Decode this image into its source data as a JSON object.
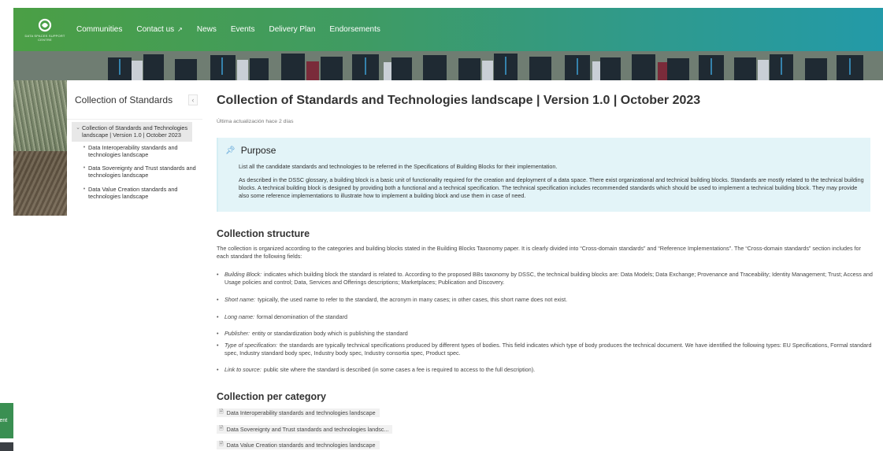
{
  "header": {
    "logo_text": "DATA SPACES SUPPORT CENTRE",
    "nav": [
      {
        "label": "Communities",
        "external": false
      },
      {
        "label": "Contact us",
        "external": true
      },
      {
        "label": "News",
        "external": false
      },
      {
        "label": "Events",
        "external": false
      },
      {
        "label": "Delivery Plan",
        "external": false
      },
      {
        "label": "Endorsements",
        "external": false
      }
    ],
    "colors": {
      "gradient_start": "#4b9f45",
      "gradient_end": "#239aa8"
    }
  },
  "sidebar": {
    "title": "Collection of Standards",
    "collapse_icon": "chevron-left-icon",
    "items": [
      {
        "label": "Collection of Standards and Technologies landscape | Version 1.0 | October 2023",
        "active": true
      },
      {
        "label": "Data Interoperability standards and technologies landscape",
        "active": false
      },
      {
        "label": "Data Sovereignty and Trust standards and technologies landscape",
        "active": false
      },
      {
        "label": "Data Value Creation standards and technologies landscape",
        "active": false
      }
    ]
  },
  "main": {
    "title": "Collection of Standards and Technologies landscape | Version 1.0 | October 2023",
    "last_updated": "Última actualización hace 2 días",
    "purpose": {
      "icon": "pin-icon",
      "title": "Purpose",
      "paragraphs": [
        "List all the candidate standards and technologies to be referred in the Specifications of Building Blocks for their implementation.",
        "As described in the DSSC glossary, a building block is a basic unit of functionality required for the creation and deployment of a data space. There exist organizational and technical building blocks. Standards are mostly related to the technical building blocks. A technical building block is designed by providing both a functional and a technical specification. The technical specification includes recommended standards which should be used to implement a technical building block. They may provide also some reference implementations to illustrate how to implement a building block and use them in case of need."
      ]
    },
    "structure": {
      "heading": "Collection structure",
      "intro": "The collection is organized according to the categories and building blocks stated in the Building Blocks Taxonomy paper. It is clearly divided into “Cross-domain standards” and “Reference Implementations”. The “Cross-domain standards” section includes for each standard the following fields:",
      "fields": [
        {
          "term": "Building Block:",
          "text": "indicates which building block the standard is related to. According to the proposed BBs taxonomy by DSSC, the technical building blocks are: Data Models; Data Exchange; Provenance and Traceability; Identity Management; Trust; Access and Usage policies and control; Data, Services and Offerings descriptions; Marketplaces; Publication and Discovery."
        },
        {
          "term": "Short name:",
          "text": "typically, the used name to refer to the standard, the acronym in many cases; in other cases, this short name does not exist."
        },
        {
          "term": "Long name:",
          "text": "formal denomination of the standard"
        },
        {
          "term": "Publisher:",
          "text": "entity or standardization body which is publishing the standard"
        },
        {
          "term": "Type of specification:",
          "text": "the standards are typically technical specifications produced by different types of bodies. This field indicates which type of body produces the technical document. We have identified the following types: EU Specifications, Formal standard spec, Industry standard body spec, Industry body spec, Industry consortia spec, Product spec."
        },
        {
          "term": "Link to source:",
          "text": "public site where the standard is described (in some cases a fee is required to access to the full description)."
        }
      ]
    },
    "per_category": {
      "heading": "Collection per category",
      "links": [
        "Data Interoperability standards and technologies landscape",
        "Data Sovereignty and Trust standards and technologies landsc...",
        "Data Value Creation standards and technologies landscape"
      ]
    }
  },
  "side_widget": {
    "label": "vent"
  }
}
